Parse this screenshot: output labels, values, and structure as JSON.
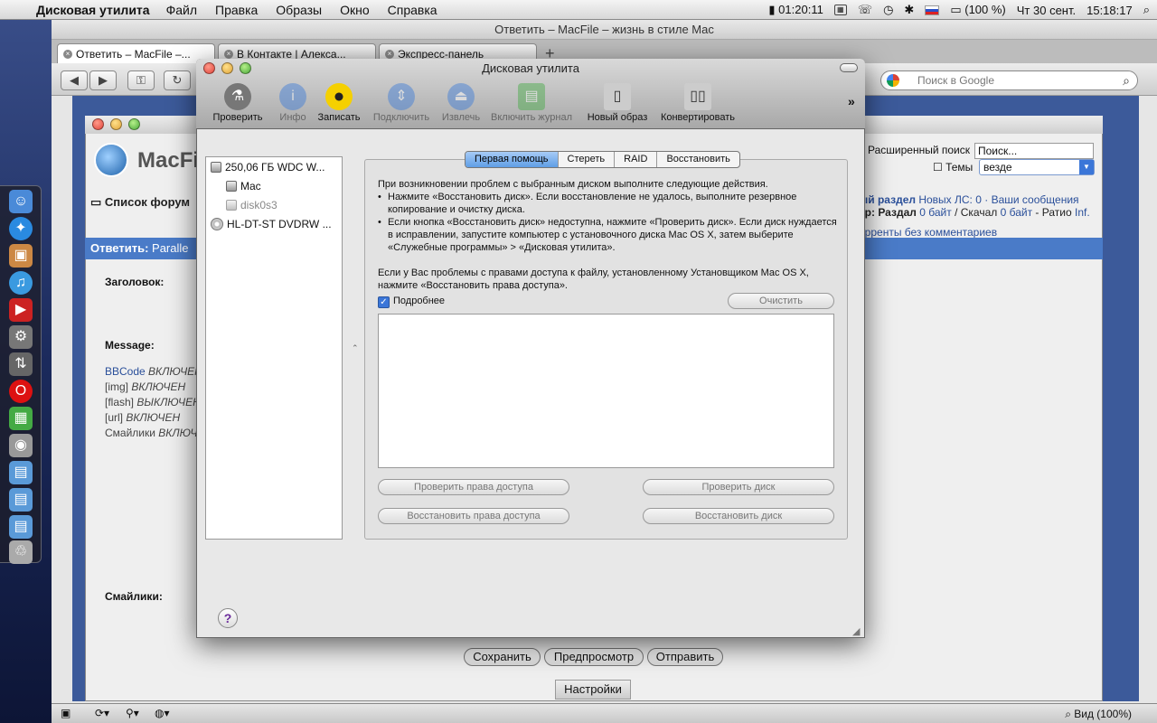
{
  "menubar": {
    "app": "Дисковая утилита",
    "items": [
      "Файл",
      "Правка",
      "Образы",
      "Окно",
      "Справка"
    ],
    "battery_time": "01:20:11",
    "battery_pct": "(100 %)",
    "date": "Чт 30 сент.",
    "time": "15:18:17"
  },
  "browser": {
    "window_title": "Ответить – MacFile – жизнь в стиле Mac",
    "tabs": [
      "Ответить – MacFile –...",
      "В Контакте | Алекса...",
      "Экспресс-панель"
    ],
    "search_placeholder": "Поиск в Google",
    "zoom": "Вид (100%)"
  },
  "forum": {
    "logo_text": "MacFi",
    "forum_list": "Список форум",
    "adv_search": "Расширенный поиск",
    "search_value": "Поиск...",
    "themes_label": "Темы",
    "scope_value": "везде",
    "right_line1_a": "ый раздел",
    "right_line1_b": "Новых ЛС: 0",
    "right_line1_c": "· Ваши сообщения",
    "right_line2_a": "ер: Раздал",
    "right_line2_b": "0 байт",
    "right_line2_c": "/ Скачал",
    "right_line2_d": "0 байт",
    "right_line2_e": "- Ратио",
    "right_line2_f": "Inf.",
    "torrents": "орренты без комментариев",
    "reply_title": "Ответить:",
    "reply_topic": "Paralle",
    "label_title": "Заголовок:",
    "label_message": "Message:",
    "bbcodes": [
      {
        "k": "BBCode",
        "v": "ВКЛЮЧЕН"
      },
      {
        "k": "[img]",
        "v": "ВКЛЮЧЕН"
      },
      {
        "k": "[flash]",
        "v": "ВЫКЛЮЧЕН"
      },
      {
        "k": "[url]",
        "v": "ВКЛЮЧЕН"
      },
      {
        "k": "Смайлики",
        "v": "ВКЛЮЧ"
      }
    ],
    "label_smiles": "Смайлики:",
    "btn_save": "Сохранить",
    "btn_preview": "Предпросмотр",
    "btn_send": "Отправить",
    "btn_settings": "Настройки"
  },
  "du": {
    "title": "Дисковая утилита",
    "toolbar": [
      {
        "label": "Проверить",
        "icon": "microscope-icon",
        "enabled": true
      },
      {
        "label": "Инфо",
        "icon": "info-icon",
        "enabled": false
      },
      {
        "label": "Записать",
        "icon": "burn-icon",
        "enabled": true
      },
      {
        "label": "Подключить",
        "icon": "mount-icon",
        "enabled": false
      },
      {
        "label": "Извлечь",
        "icon": "eject-icon",
        "enabled": false
      },
      {
        "label": "Включить журнал",
        "icon": "journal-icon",
        "enabled": false
      },
      {
        "label": "Новый образ",
        "icon": "new-image-icon",
        "enabled": true
      },
      {
        "label": "Конвертировать",
        "icon": "convert-icon",
        "enabled": true
      }
    ],
    "disks": [
      {
        "label": "250,06 ГБ WDC W...",
        "indent": 0,
        "type": "hd"
      },
      {
        "label": "Mac",
        "indent": 1,
        "type": "vol"
      },
      {
        "label": "disk0s3",
        "indent": 1,
        "type": "vol-dim"
      },
      {
        "label": "HL-DT-ST DVDRW ...",
        "indent": 0,
        "type": "cd"
      }
    ],
    "tabs": [
      "Первая помощь",
      "Стереть",
      "RAID",
      "Восстановить"
    ],
    "intro": "При возникновении проблем с выбранным диском выполните следующие действия.",
    "bullet1": "Нажмите «Восстановить диск». Если восстановление не удалось, выполните резервное копирование и очистку диска.",
    "bullet2": "Если кнопка «Восстановить диск» недоступна, нажмите «Проверить диск». Если диск нуждается в исправлении, запустите компьютер с установочного диска Mac OS X, затем выберите «Служебные программы» > «Дисковая утилита».",
    "permissions": "Если у Вас проблемы с правами доступа к файлу, установленному Установщиком Mac OS X, нажмите «Восстановить права доступа».",
    "details_label": "Подробнее",
    "clear_btn": "Очистить",
    "btn_verify_perm": "Проверить права доступа",
    "btn_verify_disk": "Проверить диск",
    "btn_repair_perm": "Восстановить права доступа",
    "btn_repair_disk": "Восстановить диск"
  }
}
